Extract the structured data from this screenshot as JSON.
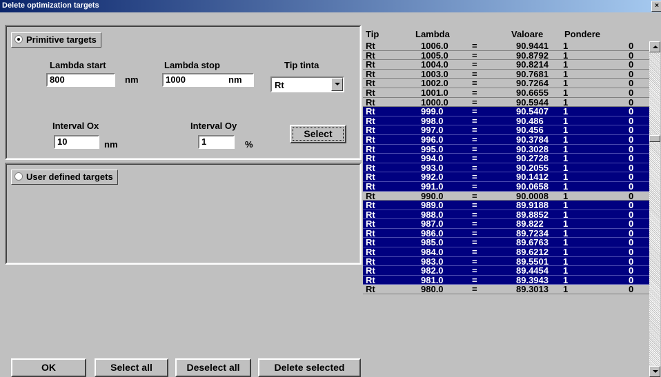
{
  "window": {
    "title": "Delete optimization targets",
    "close_label": "×"
  },
  "primitive": {
    "label": "Primitive targets",
    "lambda_start_label": "Lambda start",
    "lambda_start_value": "800",
    "lambda_start_unit": "nm",
    "lambda_stop_label": "Lambda stop",
    "lambda_stop_value": "1000",
    "lambda_stop_unit": "nm",
    "tip_tinta_label": "Tip tinta",
    "tip_tinta_value": "Rt",
    "interval_ox_label": "Interval Ox",
    "interval_ox_value": "10",
    "interval_ox_unit": "nm",
    "interval_oy_label": "Interval Oy",
    "interval_oy_value": "1",
    "interval_oy_unit": "%",
    "select_label": "Select"
  },
  "user_defined": {
    "label": "User defined targets"
  },
  "buttons": {
    "ok": "OK",
    "select_all": "Select all",
    "deselect_all": "Deselect all",
    "delete_selected": "Delete selected"
  },
  "grid": {
    "headers": {
      "tip": "Tip",
      "lambda": "Lambda",
      "valoare": "Valoare",
      "pondere": "Pondere"
    },
    "rows": [
      {
        "tip": "Rt",
        "lambda": "1006.0",
        "eq": "=",
        "val": "90.9441",
        "pon": "1",
        "z": "0",
        "selected": false
      },
      {
        "tip": "Rt",
        "lambda": "1005.0",
        "eq": "=",
        "val": "90.8792",
        "pon": "1",
        "z": "0",
        "selected": false
      },
      {
        "tip": "Rt",
        "lambda": "1004.0",
        "eq": "=",
        "val": "90.8214",
        "pon": "1",
        "z": "0",
        "selected": false
      },
      {
        "tip": "Rt",
        "lambda": "1003.0",
        "eq": "=",
        "val": "90.7681",
        "pon": "1",
        "z": "0",
        "selected": false
      },
      {
        "tip": "Rt",
        "lambda": "1002.0",
        "eq": "=",
        "val": "90.7264",
        "pon": "1",
        "z": "0",
        "selected": false
      },
      {
        "tip": "Rt",
        "lambda": "1001.0",
        "eq": "=",
        "val": "90.6655",
        "pon": "1",
        "z": "0",
        "selected": false
      },
      {
        "tip": "Rt",
        "lambda": "1000.0",
        "eq": "=",
        "val": "90.5944",
        "pon": "1",
        "z": "0",
        "selected": false
      },
      {
        "tip": "Rt",
        "lambda": "999.0",
        "eq": "=",
        "val": "90.5407",
        "pon": "1",
        "z": "0",
        "selected": true
      },
      {
        "tip": "Rt",
        "lambda": "998.0",
        "eq": "=",
        "val": "90.486",
        "pon": "1",
        "z": "0",
        "selected": true
      },
      {
        "tip": "Rt",
        "lambda": "997.0",
        "eq": "=",
        "val": "90.456",
        "pon": "1",
        "z": "0",
        "selected": true
      },
      {
        "tip": "Rt",
        "lambda": "996.0",
        "eq": "=",
        "val": "90.3784",
        "pon": "1",
        "z": "0",
        "selected": true
      },
      {
        "tip": "Rt",
        "lambda": "995.0",
        "eq": "=",
        "val": "90.3028",
        "pon": "1",
        "z": "0",
        "selected": true
      },
      {
        "tip": "Rt",
        "lambda": "994.0",
        "eq": "=",
        "val": "90.2728",
        "pon": "1",
        "z": "0",
        "selected": true
      },
      {
        "tip": "Rt",
        "lambda": "993.0",
        "eq": "=",
        "val": "90.2055",
        "pon": "1",
        "z": "0",
        "selected": true
      },
      {
        "tip": "Rt",
        "lambda": "992.0",
        "eq": "=",
        "val": "90.1412",
        "pon": "1",
        "z": "0",
        "selected": true
      },
      {
        "tip": "Rt",
        "lambda": "991.0",
        "eq": "=",
        "val": "90.0658",
        "pon": "1",
        "z": "0",
        "selected": true
      },
      {
        "tip": "Rt",
        "lambda": "990.0",
        "eq": "=",
        "val": "90.0008",
        "pon": "1",
        "z": "0",
        "selected": false
      },
      {
        "tip": "Rt",
        "lambda": "989.0",
        "eq": "=",
        "val": "89.9188",
        "pon": "1",
        "z": "0",
        "selected": true
      },
      {
        "tip": "Rt",
        "lambda": "988.0",
        "eq": "=",
        "val": "89.8852",
        "pon": "1",
        "z": "0",
        "selected": true
      },
      {
        "tip": "Rt",
        "lambda": "987.0",
        "eq": "=",
        "val": "89.822",
        "pon": "1",
        "z": "0",
        "selected": true
      },
      {
        "tip": "Rt",
        "lambda": "986.0",
        "eq": "=",
        "val": "89.7234",
        "pon": "1",
        "z": "0",
        "selected": true
      },
      {
        "tip": "Rt",
        "lambda": "985.0",
        "eq": "=",
        "val": "89.6763",
        "pon": "1",
        "z": "0",
        "selected": true
      },
      {
        "tip": "Rt",
        "lambda": "984.0",
        "eq": "=",
        "val": "89.6212",
        "pon": "1",
        "z": "0",
        "selected": true
      },
      {
        "tip": "Rt",
        "lambda": "983.0",
        "eq": "=",
        "val": "89.5501",
        "pon": "1",
        "z": "0",
        "selected": true
      },
      {
        "tip": "Rt",
        "lambda": "982.0",
        "eq": "=",
        "val": "89.4454",
        "pon": "1",
        "z": "0",
        "selected": true
      },
      {
        "tip": "Rt",
        "lambda": "981.0",
        "eq": "=",
        "val": "89.3943",
        "pon": "1",
        "z": "0",
        "selected": true
      },
      {
        "tip": "Rt",
        "lambda": "980.0",
        "eq": "=",
        "val": "89.3013",
        "pon": "1",
        "z": "0",
        "selected": false
      }
    ]
  },
  "colors": {
    "title_start": "#0a246a",
    "title_end": "#a6caf0",
    "selection": "#000080",
    "face": "#c0c0c0"
  }
}
